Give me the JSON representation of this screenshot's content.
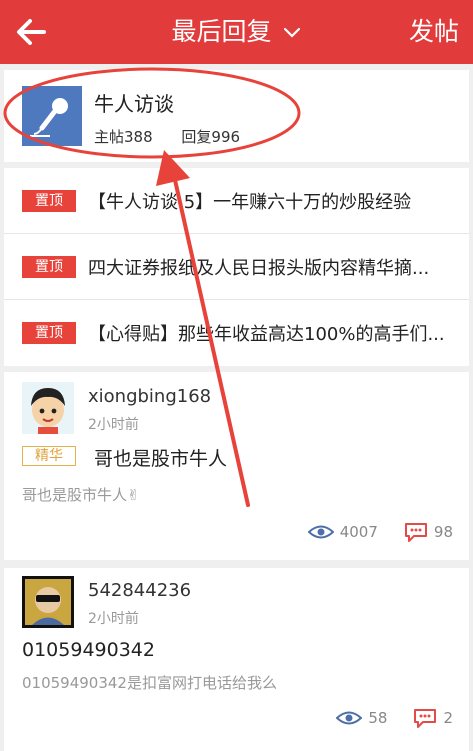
{
  "header": {
    "title": "最后回复",
    "post_label": "发帖"
  },
  "forum": {
    "name": "牛人访谈",
    "posts_label": "主帖388",
    "replies_label": "回复996"
  },
  "pinned": {
    "badge": "置顶",
    "items": [
      {
        "title": "【牛人访谈.5】一年赚六十万的炒股经验"
      },
      {
        "title": "四大证券报纸及人民日报头版内容精华摘..."
      },
      {
        "title": "【心得贴】那些年收益高达100%的高手们..."
      }
    ]
  },
  "posts": [
    {
      "user": "xiongbing168",
      "time": "2小时前",
      "tag": "精华",
      "title": "哥也是股市牛人",
      "summary": "哥也是股市牛人✌",
      "views": "4007",
      "comments": "98"
    },
    {
      "user": "542844236",
      "time": "2小时前",
      "title": "01059490342",
      "summary": "01059490342是扣富网打电话给我么",
      "views": "58",
      "comments": "2"
    }
  ],
  "colors": {
    "header_bg": "#e23b3b",
    "pin_badge": "#e8433a",
    "tag_border": "#e2b24d",
    "stat_icon": "#4f6fa8",
    "comment_icon": "#e34b4b",
    "annotation": "#e8433a"
  },
  "icons": {
    "back": "arrow-left-icon",
    "title_dropdown": "chevron-down-icon",
    "forum_avatar": "microphone-icon",
    "views": "eye-icon",
    "comments": "comment-icon"
  }
}
